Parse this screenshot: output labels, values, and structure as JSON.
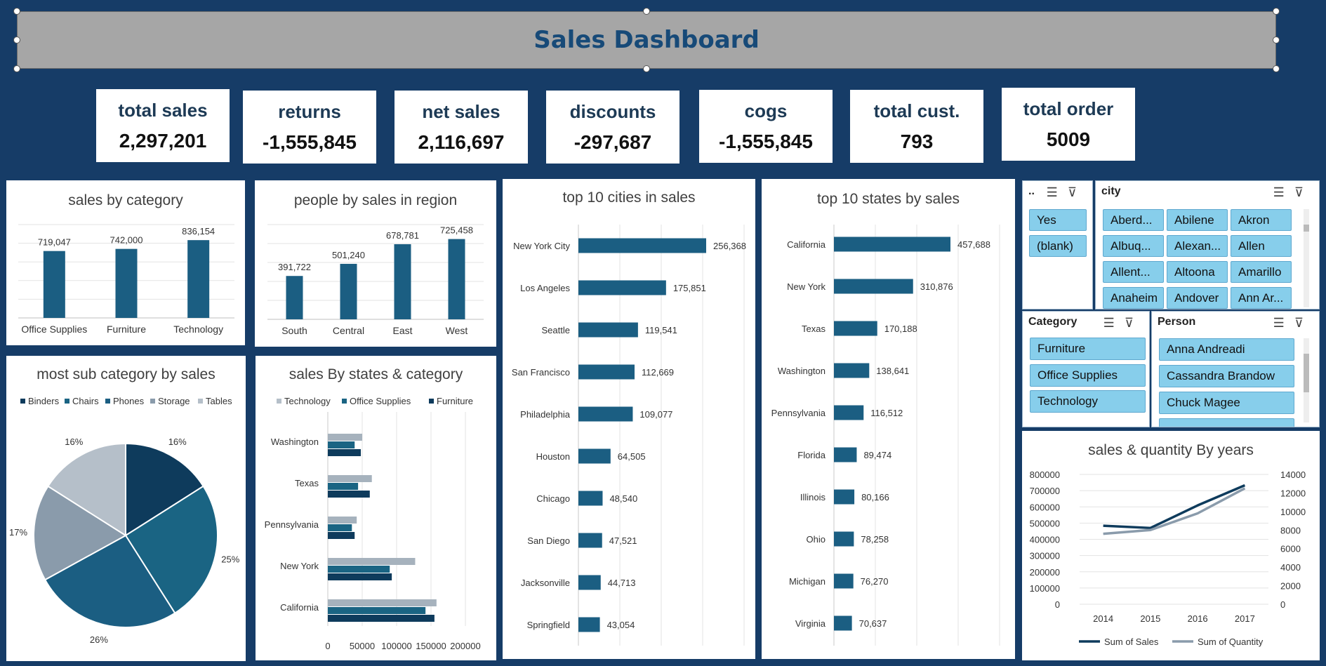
{
  "title": "Sales Dashboard",
  "kpis": [
    {
      "label": "total sales",
      "value": "2,297,201"
    },
    {
      "label": "returns",
      "value": "-1,555,845"
    },
    {
      "label": "net sales",
      "value": "2,116,697"
    },
    {
      "label": "discounts",
      "value": "-297,687"
    },
    {
      "label": "cogs",
      "value": "-1,555,845"
    },
    {
      "label": "total cust.",
      "value": "793"
    },
    {
      "label": "total order",
      "value": "5009"
    }
  ],
  "colors": {
    "background": "#163c67",
    "dark_teal": "#1b5e82",
    "navy": "#0e3b5c",
    "mid_blue": "#1a6483",
    "slate": "#8a9bab",
    "light_slate": "#b5bfc9",
    "slicer_button": "#87ceeb"
  },
  "chart_data": [
    {
      "id": "sales-by-category",
      "type": "bar",
      "title": "sales by category",
      "categories": [
        "Office Supplies",
        "Furniture",
        "Technology"
      ],
      "values": [
        719047,
        742000,
        836154
      ],
      "labels": [
        "719,047",
        "742,000",
        "836,154"
      ]
    },
    {
      "id": "people-by-sales-in-region",
      "type": "bar",
      "title": "people by sales in region",
      "categories": [
        "South",
        "Central",
        "East",
        "West"
      ],
      "values": [
        391722,
        501240,
        678781,
        725458
      ],
      "labels": [
        "391,722",
        "501,240",
        "678,781",
        "725,458"
      ]
    },
    {
      "id": "top-10-cities",
      "type": "bar",
      "orientation": "horizontal",
      "title": "top 10 cities in sales",
      "categories": [
        "New York City",
        "Los Angeles",
        "Seattle",
        "San Francisco",
        "Philadelphia",
        "Houston",
        "Chicago",
        "San Diego",
        "Jacksonville",
        "Springfield"
      ],
      "values": [
        256368,
        175851,
        119541,
        112669,
        109077,
        64505,
        48540,
        47521,
        44713,
        43054
      ],
      "labels": [
        "256,368",
        "175,851",
        "119,541",
        "112,669",
        "109,077",
        "64,505",
        "48,540",
        "47,521",
        "44,713",
        "43,054"
      ]
    },
    {
      "id": "top-10-states",
      "type": "bar",
      "orientation": "horizontal",
      "title": "top 10 states by sales",
      "categories": [
        "California",
        "New York",
        "Texas",
        "Washington",
        "Pennsylvania",
        "Florida",
        "Illinois",
        "Ohio",
        "Michigan",
        "Virginia"
      ],
      "values": [
        457688,
        310876,
        170188,
        138641,
        116512,
        89474,
        80166,
        78258,
        76270,
        70637
      ],
      "labels": [
        "457,688",
        "310,876",
        "170,188",
        "138,641",
        "116,512",
        "89,474",
        "80,166",
        "78,258",
        "76,270",
        "70,637"
      ]
    },
    {
      "id": "most-sub-category",
      "type": "pie",
      "title": "most sub category by sales",
      "legend": [
        "Binders",
        "Chairs",
        "Phones",
        "Storage",
        "Tables"
      ],
      "values": [
        16,
        25,
        26,
        17,
        16
      ],
      "labels": [
        "16%",
        "25%",
        "26%",
        "17%",
        "16%"
      ],
      "legend_position": "top"
    },
    {
      "id": "sales-by-states-category",
      "type": "bar",
      "orientation": "horizontal",
      "title": "sales By states & category",
      "categories": [
        "Washington",
        "Texas",
        "Pennsylvania",
        "New York",
        "California"
      ],
      "series": [
        {
          "name": "Technology",
          "values": [
            50000,
            64000,
            42000,
            127000,
            158000
          ]
        },
        {
          "name": "Office Supplies",
          "values": [
            39000,
            44000,
            35000,
            90000,
            142000
          ]
        },
        {
          "name": "Furniture",
          "values": [
            48000,
            61000,
            39000,
            93000,
            155000
          ]
        }
      ],
      "xticks": [
        "0",
        "50000",
        "100000",
        "150000",
        "200000"
      ],
      "xlim": [
        0,
        200000
      ],
      "legend_position": "top"
    },
    {
      "id": "sales-quantity-by-years",
      "type": "line",
      "title": "sales & quantity By years",
      "categories": [
        "2014",
        "2015",
        "2016",
        "2017"
      ],
      "series": [
        {
          "name": "Sum of Sales",
          "axis": "left",
          "values": [
            484000,
            470000,
            609000,
            733000
          ]
        },
        {
          "name": "Sum of Quantity",
          "axis": "right",
          "values": [
            7600,
            8000,
            9800,
            12500
          ]
        }
      ],
      "yticks_left": [
        "800000",
        "700000",
        "600000",
        "500000",
        "400000",
        "300000",
        "200000",
        "100000",
        "0"
      ],
      "yticks_right": [
        "14000",
        "12000",
        "10000",
        "8000",
        "6000",
        "4000",
        "2000",
        "0"
      ],
      "ylim_left": [
        0,
        800000
      ],
      "ylim_right": [
        0,
        14000
      ],
      "legend_position": "bottom"
    }
  ],
  "slicers": {
    "flag": {
      "header": "..",
      "items": [
        "Yes",
        "(blank)"
      ]
    },
    "city": {
      "header": "city",
      "items": [
        "Aberd...",
        "Abilene",
        "Akron",
        "Albuq...",
        "Alexan...",
        "Allen",
        "Allent...",
        "Altoona",
        "Amarillo",
        "Anaheim",
        "Andover",
        "Ann Ar..."
      ]
    },
    "category": {
      "header": "Category",
      "items": [
        "Furniture",
        "Office Supplies",
        "Technology"
      ]
    },
    "person": {
      "header": "Person",
      "items": [
        "Anna Andreadi",
        "Cassandra Brandow",
        "Chuck Magee",
        ""
      ]
    }
  }
}
